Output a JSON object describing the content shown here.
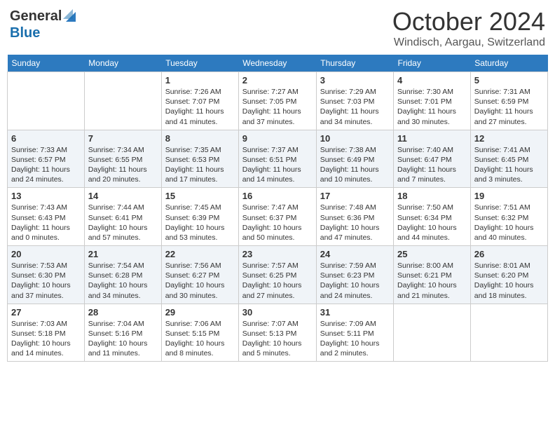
{
  "header": {
    "logo_general": "General",
    "logo_blue": "Blue",
    "month": "October 2024",
    "location": "Windisch, Aargau, Switzerland"
  },
  "days_of_week": [
    "Sunday",
    "Monday",
    "Tuesday",
    "Wednesday",
    "Thursday",
    "Friday",
    "Saturday"
  ],
  "weeks": [
    [
      {
        "day": "",
        "info": ""
      },
      {
        "day": "",
        "info": ""
      },
      {
        "day": "1",
        "info": "Sunrise: 7:26 AM\nSunset: 7:07 PM\nDaylight: 11 hours and 41 minutes."
      },
      {
        "day": "2",
        "info": "Sunrise: 7:27 AM\nSunset: 7:05 PM\nDaylight: 11 hours and 37 minutes."
      },
      {
        "day": "3",
        "info": "Sunrise: 7:29 AM\nSunset: 7:03 PM\nDaylight: 11 hours and 34 minutes."
      },
      {
        "day": "4",
        "info": "Sunrise: 7:30 AM\nSunset: 7:01 PM\nDaylight: 11 hours and 30 minutes."
      },
      {
        "day": "5",
        "info": "Sunrise: 7:31 AM\nSunset: 6:59 PM\nDaylight: 11 hours and 27 minutes."
      }
    ],
    [
      {
        "day": "6",
        "info": "Sunrise: 7:33 AM\nSunset: 6:57 PM\nDaylight: 11 hours and 24 minutes."
      },
      {
        "day": "7",
        "info": "Sunrise: 7:34 AM\nSunset: 6:55 PM\nDaylight: 11 hours and 20 minutes."
      },
      {
        "day": "8",
        "info": "Sunrise: 7:35 AM\nSunset: 6:53 PM\nDaylight: 11 hours and 17 minutes."
      },
      {
        "day": "9",
        "info": "Sunrise: 7:37 AM\nSunset: 6:51 PM\nDaylight: 11 hours and 14 minutes."
      },
      {
        "day": "10",
        "info": "Sunrise: 7:38 AM\nSunset: 6:49 PM\nDaylight: 11 hours and 10 minutes."
      },
      {
        "day": "11",
        "info": "Sunrise: 7:40 AM\nSunset: 6:47 PM\nDaylight: 11 hours and 7 minutes."
      },
      {
        "day": "12",
        "info": "Sunrise: 7:41 AM\nSunset: 6:45 PM\nDaylight: 11 hours and 3 minutes."
      }
    ],
    [
      {
        "day": "13",
        "info": "Sunrise: 7:43 AM\nSunset: 6:43 PM\nDaylight: 11 hours and 0 minutes."
      },
      {
        "day": "14",
        "info": "Sunrise: 7:44 AM\nSunset: 6:41 PM\nDaylight: 10 hours and 57 minutes."
      },
      {
        "day": "15",
        "info": "Sunrise: 7:45 AM\nSunset: 6:39 PM\nDaylight: 10 hours and 53 minutes."
      },
      {
        "day": "16",
        "info": "Sunrise: 7:47 AM\nSunset: 6:37 PM\nDaylight: 10 hours and 50 minutes."
      },
      {
        "day": "17",
        "info": "Sunrise: 7:48 AM\nSunset: 6:36 PM\nDaylight: 10 hours and 47 minutes."
      },
      {
        "day": "18",
        "info": "Sunrise: 7:50 AM\nSunset: 6:34 PM\nDaylight: 10 hours and 44 minutes."
      },
      {
        "day": "19",
        "info": "Sunrise: 7:51 AM\nSunset: 6:32 PM\nDaylight: 10 hours and 40 minutes."
      }
    ],
    [
      {
        "day": "20",
        "info": "Sunrise: 7:53 AM\nSunset: 6:30 PM\nDaylight: 10 hours and 37 minutes."
      },
      {
        "day": "21",
        "info": "Sunrise: 7:54 AM\nSunset: 6:28 PM\nDaylight: 10 hours and 34 minutes."
      },
      {
        "day": "22",
        "info": "Sunrise: 7:56 AM\nSunset: 6:27 PM\nDaylight: 10 hours and 30 minutes."
      },
      {
        "day": "23",
        "info": "Sunrise: 7:57 AM\nSunset: 6:25 PM\nDaylight: 10 hours and 27 minutes."
      },
      {
        "day": "24",
        "info": "Sunrise: 7:59 AM\nSunset: 6:23 PM\nDaylight: 10 hours and 24 minutes."
      },
      {
        "day": "25",
        "info": "Sunrise: 8:00 AM\nSunset: 6:21 PM\nDaylight: 10 hours and 21 minutes."
      },
      {
        "day": "26",
        "info": "Sunrise: 8:01 AM\nSunset: 6:20 PM\nDaylight: 10 hours and 18 minutes."
      }
    ],
    [
      {
        "day": "27",
        "info": "Sunrise: 7:03 AM\nSunset: 5:18 PM\nDaylight: 10 hours and 14 minutes."
      },
      {
        "day": "28",
        "info": "Sunrise: 7:04 AM\nSunset: 5:16 PM\nDaylight: 10 hours and 11 minutes."
      },
      {
        "day": "29",
        "info": "Sunrise: 7:06 AM\nSunset: 5:15 PM\nDaylight: 10 hours and 8 minutes."
      },
      {
        "day": "30",
        "info": "Sunrise: 7:07 AM\nSunset: 5:13 PM\nDaylight: 10 hours and 5 minutes."
      },
      {
        "day": "31",
        "info": "Sunrise: 7:09 AM\nSunset: 5:11 PM\nDaylight: 10 hours and 2 minutes."
      },
      {
        "day": "",
        "info": ""
      },
      {
        "day": "",
        "info": ""
      }
    ]
  ]
}
